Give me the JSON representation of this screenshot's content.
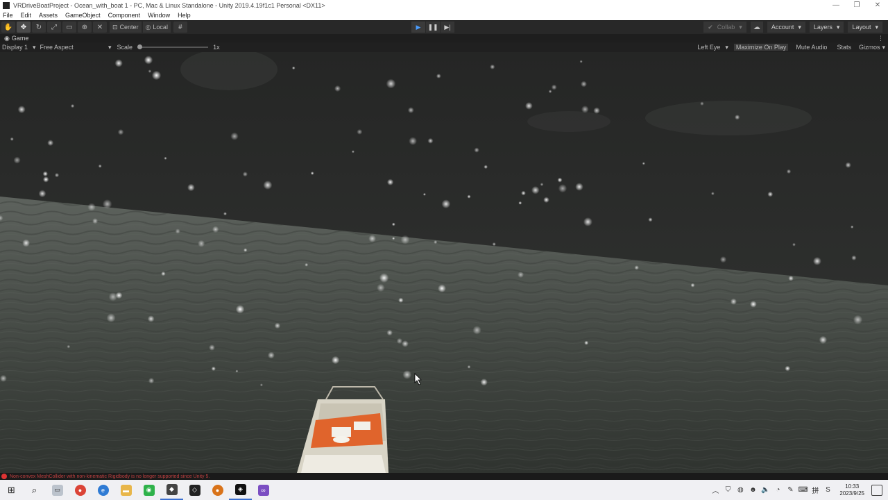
{
  "window": {
    "title": "VRDriveBoatProject - Ocean_with_boat 1 - PC, Mac & Linux Standalone - Unity 2019.4.19f1c1 Personal <DX11>",
    "minimize": "—",
    "maximize": "❐",
    "close": "✕"
  },
  "menu": [
    "File",
    "Edit",
    "Assets",
    "GameObject",
    "Component",
    "Window",
    "Help"
  ],
  "toolbar": {
    "center_label": "Center",
    "local_label": "Local",
    "collab_label": "Collab",
    "account_label": "Account",
    "layers_label": "Layers",
    "layout_label": "Layout"
  },
  "game_tab": {
    "label": "Game"
  },
  "game_bar": {
    "display": "Display 1",
    "aspect": "Free Aspect",
    "scale_label": "Scale",
    "scale_value": "1x",
    "eye": "Left Eye",
    "maximize": "Maximize On Play",
    "mute": "Mute Audio",
    "stats": "Stats",
    "gizmos": "Gizmos"
  },
  "status": {
    "message": "Non-convex MeshCollider with non-kinematic Rigidbody is no longer supported since Unity 5."
  },
  "taskbar": {
    "time": "10:33",
    "date": "2023/9/25"
  },
  "colors": {
    "sky": "#2b2d2b",
    "sea": "#4a4f4a",
    "boat_canopy": "#e0642c"
  }
}
